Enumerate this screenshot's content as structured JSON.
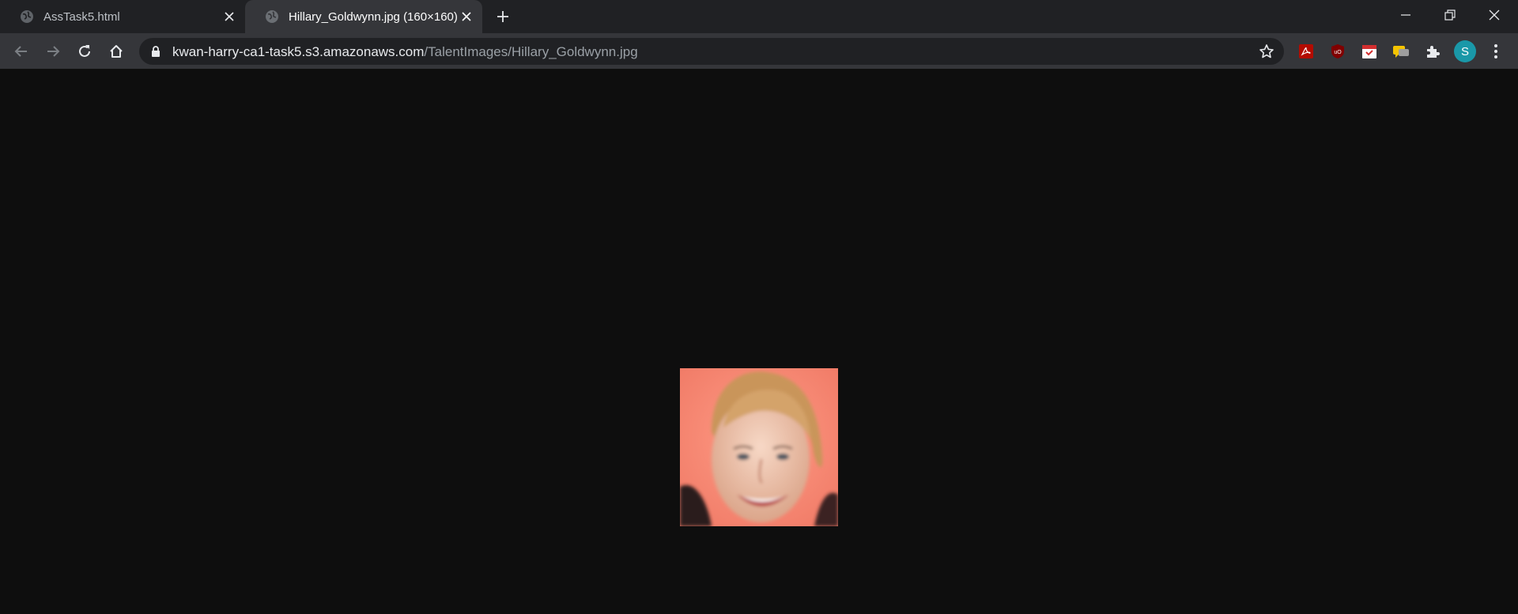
{
  "tabs": [
    {
      "title": "AssTask5.html",
      "icon": "globe-icon",
      "active": false
    },
    {
      "title": "Hillary_Goldwynn.jpg (160×160)",
      "icon": "globe-icon",
      "active": true
    }
  ],
  "address_bar": {
    "host": "kwan-harry-ca1-task5.s3.amazonaws.com",
    "path": "/TalentImages/Hillary_Goldwynn.jpg"
  },
  "profile": {
    "initial": "S",
    "color": "#1a98a8"
  },
  "image": {
    "alt": "Hillary_Goldwynn.jpg",
    "width": 160,
    "height": 160
  },
  "theme": {
    "tabstrip": "#202124",
    "toolbar": "#35363a",
    "page_bg": "#0e0e0e"
  }
}
